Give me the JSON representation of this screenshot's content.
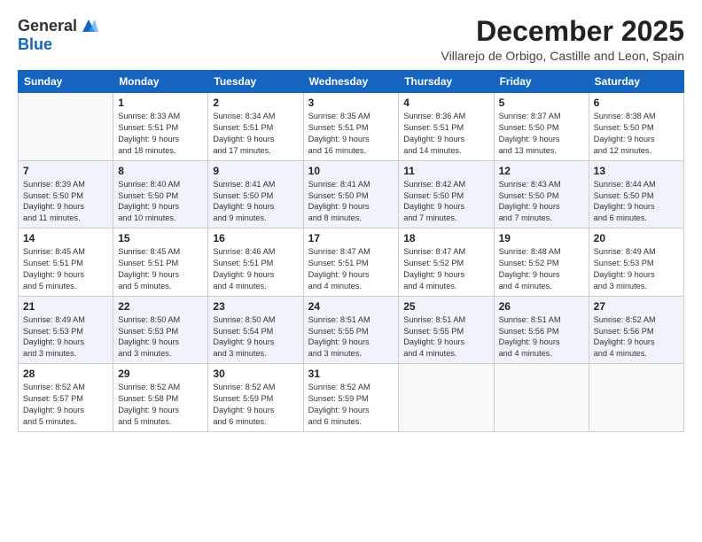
{
  "logo": {
    "general": "General",
    "blue": "Blue"
  },
  "title": "December 2025",
  "subtitle": "Villarejo de Orbigo, Castille and Leon, Spain",
  "weekdays": [
    "Sunday",
    "Monday",
    "Tuesday",
    "Wednesday",
    "Thursday",
    "Friday",
    "Saturday"
  ],
  "weeks": [
    [
      {
        "day": "",
        "info": ""
      },
      {
        "day": "1",
        "info": "Sunrise: 8:33 AM\nSunset: 5:51 PM\nDaylight: 9 hours\nand 18 minutes."
      },
      {
        "day": "2",
        "info": "Sunrise: 8:34 AM\nSunset: 5:51 PM\nDaylight: 9 hours\nand 17 minutes."
      },
      {
        "day": "3",
        "info": "Sunrise: 8:35 AM\nSunset: 5:51 PM\nDaylight: 9 hours\nand 16 minutes."
      },
      {
        "day": "4",
        "info": "Sunrise: 8:36 AM\nSunset: 5:51 PM\nDaylight: 9 hours\nand 14 minutes."
      },
      {
        "day": "5",
        "info": "Sunrise: 8:37 AM\nSunset: 5:50 PM\nDaylight: 9 hours\nand 13 minutes."
      },
      {
        "day": "6",
        "info": "Sunrise: 8:38 AM\nSunset: 5:50 PM\nDaylight: 9 hours\nand 12 minutes."
      }
    ],
    [
      {
        "day": "7",
        "info": "Sunrise: 8:39 AM\nSunset: 5:50 PM\nDaylight: 9 hours\nand 11 minutes."
      },
      {
        "day": "8",
        "info": "Sunrise: 8:40 AM\nSunset: 5:50 PM\nDaylight: 9 hours\nand 10 minutes."
      },
      {
        "day": "9",
        "info": "Sunrise: 8:41 AM\nSunset: 5:50 PM\nDaylight: 9 hours\nand 9 minutes."
      },
      {
        "day": "10",
        "info": "Sunrise: 8:41 AM\nSunset: 5:50 PM\nDaylight: 9 hours\nand 8 minutes."
      },
      {
        "day": "11",
        "info": "Sunrise: 8:42 AM\nSunset: 5:50 PM\nDaylight: 9 hours\nand 7 minutes."
      },
      {
        "day": "12",
        "info": "Sunrise: 8:43 AM\nSunset: 5:50 PM\nDaylight: 9 hours\nand 7 minutes."
      },
      {
        "day": "13",
        "info": "Sunrise: 8:44 AM\nSunset: 5:50 PM\nDaylight: 9 hours\nand 6 minutes."
      }
    ],
    [
      {
        "day": "14",
        "info": "Sunrise: 8:45 AM\nSunset: 5:51 PM\nDaylight: 9 hours\nand 5 minutes."
      },
      {
        "day": "15",
        "info": "Sunrise: 8:45 AM\nSunset: 5:51 PM\nDaylight: 9 hours\nand 5 minutes."
      },
      {
        "day": "16",
        "info": "Sunrise: 8:46 AM\nSunset: 5:51 PM\nDaylight: 9 hours\nand 4 minutes."
      },
      {
        "day": "17",
        "info": "Sunrise: 8:47 AM\nSunset: 5:51 PM\nDaylight: 9 hours\nand 4 minutes."
      },
      {
        "day": "18",
        "info": "Sunrise: 8:47 AM\nSunset: 5:52 PM\nDaylight: 9 hours\nand 4 minutes."
      },
      {
        "day": "19",
        "info": "Sunrise: 8:48 AM\nSunset: 5:52 PM\nDaylight: 9 hours\nand 4 minutes."
      },
      {
        "day": "20",
        "info": "Sunrise: 8:49 AM\nSunset: 5:53 PM\nDaylight: 9 hours\nand 3 minutes."
      }
    ],
    [
      {
        "day": "21",
        "info": "Sunrise: 8:49 AM\nSunset: 5:53 PM\nDaylight: 9 hours\nand 3 minutes."
      },
      {
        "day": "22",
        "info": "Sunrise: 8:50 AM\nSunset: 5:53 PM\nDaylight: 9 hours\nand 3 minutes."
      },
      {
        "day": "23",
        "info": "Sunrise: 8:50 AM\nSunset: 5:54 PM\nDaylight: 9 hours\nand 3 minutes."
      },
      {
        "day": "24",
        "info": "Sunrise: 8:51 AM\nSunset: 5:55 PM\nDaylight: 9 hours\nand 3 minutes."
      },
      {
        "day": "25",
        "info": "Sunrise: 8:51 AM\nSunset: 5:55 PM\nDaylight: 9 hours\nand 4 minutes."
      },
      {
        "day": "26",
        "info": "Sunrise: 8:51 AM\nSunset: 5:56 PM\nDaylight: 9 hours\nand 4 minutes."
      },
      {
        "day": "27",
        "info": "Sunrise: 8:52 AM\nSunset: 5:56 PM\nDaylight: 9 hours\nand 4 minutes."
      }
    ],
    [
      {
        "day": "28",
        "info": "Sunrise: 8:52 AM\nSunset: 5:57 PM\nDaylight: 9 hours\nand 5 minutes."
      },
      {
        "day": "29",
        "info": "Sunrise: 8:52 AM\nSunset: 5:58 PM\nDaylight: 9 hours\nand 5 minutes."
      },
      {
        "day": "30",
        "info": "Sunrise: 8:52 AM\nSunset: 5:59 PM\nDaylight: 9 hours\nand 6 minutes."
      },
      {
        "day": "31",
        "info": "Sunrise: 8:52 AM\nSunset: 5:59 PM\nDaylight: 9 hours\nand 6 minutes."
      },
      {
        "day": "",
        "info": ""
      },
      {
        "day": "",
        "info": ""
      },
      {
        "day": "",
        "info": ""
      }
    ]
  ]
}
